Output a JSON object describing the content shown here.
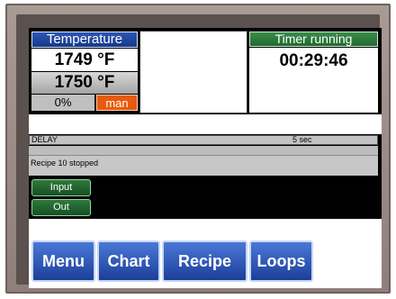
{
  "temperature": {
    "title": "Temperature",
    "process_value": "1749 °F",
    "setpoint": "1750 °F",
    "output_percent": "0%",
    "mode": "man"
  },
  "timer": {
    "title": "Timer running",
    "value": "00:29:46"
  },
  "delay": {
    "label": "DELAY",
    "value": "5 sec"
  },
  "status": {
    "message": "Recipe 10 stopped"
  },
  "io_buttons": {
    "input_label": "Input",
    "output_label": "Out"
  },
  "nav": {
    "menu": "Menu",
    "chart": "Chart",
    "recipe": "Recipe",
    "loops": "Loops"
  },
  "colors": {
    "title_blue": "#1f4aa8",
    "timer_green": "#2a7a3a",
    "mode_orange": "#e85a0e",
    "screen_black": "#000000"
  }
}
